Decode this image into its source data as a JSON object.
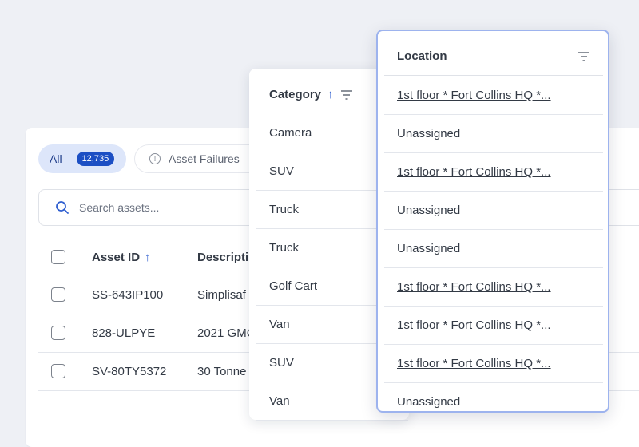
{
  "filters": {
    "all_label": "All",
    "all_count": "12,735",
    "failures_label": "Asset Failures"
  },
  "search": {
    "placeholder": "Search assets..."
  },
  "table": {
    "headers": {
      "asset_id": "Asset ID",
      "description": "Descripti"
    },
    "rows": [
      {
        "asset_id": "SS-643IP100",
        "description": "Simplisaf"
      },
      {
        "asset_id": "828-ULPYE",
        "description": "2021 GMC"
      },
      {
        "asset_id": "SV-80TY5372",
        "description": "30 Tonne"
      }
    ]
  },
  "category_column": {
    "header": "Category",
    "cells": [
      "Camera",
      "SUV",
      "Truck",
      "Truck",
      "Golf Cart",
      "Van",
      "SUV",
      "Van"
    ]
  },
  "location_column": {
    "header": "Location",
    "cells": [
      "1st floor * Fort Collins HQ *...",
      "Unassigned",
      "1st floor * Fort Collins HQ *...",
      "Unassigned",
      "Unassigned",
      "1st floor * Fort Collins HQ *...",
      "1st floor * Fort Collins HQ *...",
      "1st floor * Fort Collins HQ *...",
      "Unassigned"
    ]
  },
  "colors": {
    "accent": "#1c4fc4",
    "highlight_border": "#9db3ee",
    "background": "#eef0f5"
  }
}
